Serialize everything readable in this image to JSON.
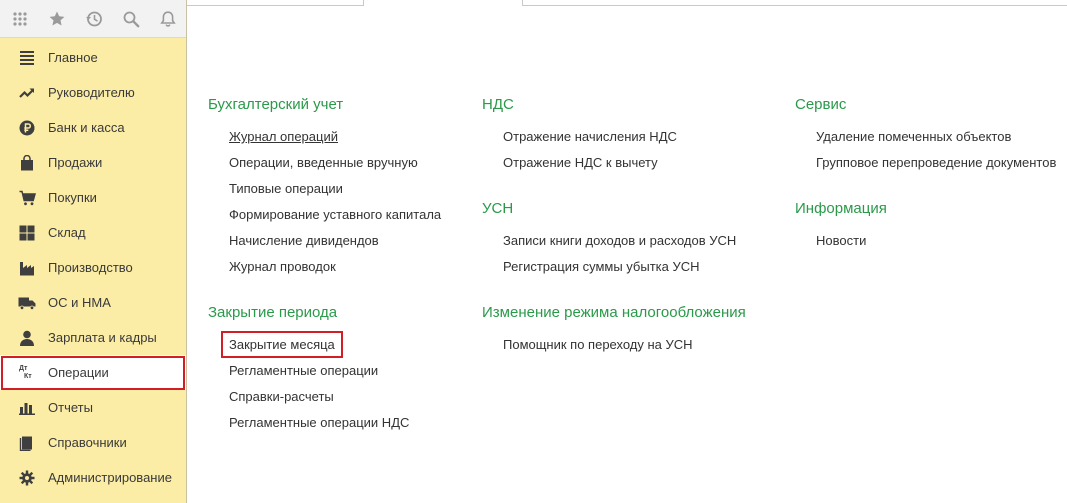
{
  "sidebar": {
    "toolbar": [
      {
        "icon": "apps-grid-icon"
      },
      {
        "icon": "star-icon"
      },
      {
        "icon": "history-icon"
      },
      {
        "icon": "search-icon"
      },
      {
        "icon": "bell-icon"
      }
    ],
    "items": [
      {
        "label": "Главное",
        "icon": "menu-lines-icon"
      },
      {
        "label": "Руководителю",
        "icon": "trend-arrow-icon"
      },
      {
        "label": "Банк и касса",
        "icon": "ruble-coin-icon"
      },
      {
        "label": "Продажи",
        "icon": "shopping-bag-icon"
      },
      {
        "label": "Покупки",
        "icon": "cart-icon"
      },
      {
        "label": "Склад",
        "icon": "warehouse-grid-icon"
      },
      {
        "label": "Производство",
        "icon": "factory-icon"
      },
      {
        "label": "ОС и НМА",
        "icon": "truck-icon"
      },
      {
        "label": "Зарплата и кадры",
        "icon": "person-icon"
      },
      {
        "label": "Операции",
        "icon": "dt-kt-icon",
        "icon_text_top": "Дт",
        "icon_text_bottom": "Кт",
        "active": true
      },
      {
        "label": "Отчеты",
        "icon": "bar-chart-icon"
      },
      {
        "label": "Справочники",
        "icon": "book-icon"
      },
      {
        "label": "Администрирование",
        "icon": "gear-icon"
      }
    ]
  },
  "colors": {
    "sidebar_bg": "#fbeca6",
    "section_title": "#2a9a4a",
    "highlight": "#d21f27"
  },
  "sections": {
    "accounting": {
      "title": "Бухгалтерский учет",
      "links": [
        "Журнал операций",
        "Операции, введенные вручную",
        "Типовые операции",
        "Формирование уставного капитала",
        "Начисление дивидендов",
        "Журнал проводок"
      ]
    },
    "period_closing": {
      "title": "Закрытие периода",
      "links": [
        "Закрытие месяца",
        "Регламентные операции",
        "Справки-расчеты",
        "Регламентные операции НДС"
      ]
    },
    "vat": {
      "title": "НДС",
      "links": [
        "Отражение начисления НДС",
        "Отражение НДС к вычету"
      ]
    },
    "usn": {
      "title": "УСН",
      "links": [
        "Записи книги доходов и расходов УСН",
        "Регистрация суммы убытка УСН"
      ]
    },
    "tax_mode": {
      "title": "Изменение режима налогообложения",
      "links": [
        "Помощник по переходу на УСН"
      ]
    },
    "service": {
      "title": "Сервис",
      "links": [
        "Удаление помеченных объектов",
        "Групповое перепроведение документов"
      ]
    },
    "info": {
      "title": "Информация",
      "links": [
        "Новости"
      ]
    }
  }
}
